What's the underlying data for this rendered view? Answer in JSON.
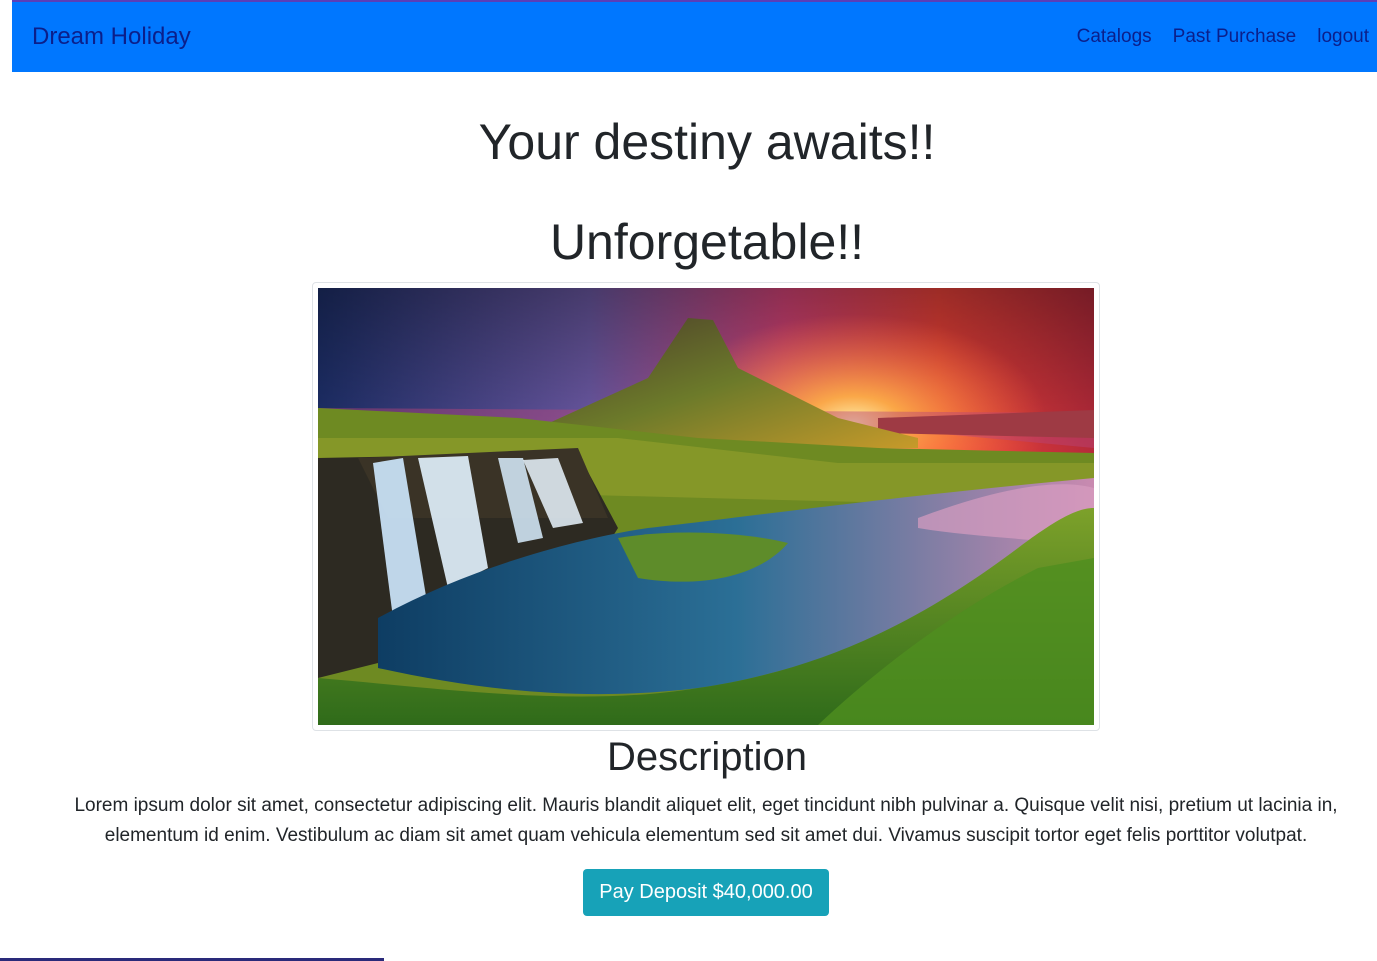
{
  "colors": {
    "navbar_bg": "#0077ff",
    "nav_text": "#0b1f8a",
    "button_bg": "#17a2b8"
  },
  "navbar": {
    "brand": "Dream Holiday",
    "links": [
      {
        "label": "Catalogs"
      },
      {
        "label": "Past Purchase"
      },
      {
        "label": "logout"
      }
    ]
  },
  "main": {
    "heading": "Your destiny awaits!!",
    "subheading": "Unforgetable!!",
    "image": {
      "subject": "waterfall-mountain-sunset-landscape"
    },
    "description_title": "Description",
    "description_text": "Lorem ipsum dolor sit amet, consectetur adipiscing elit. Mauris blandit aliquet elit, eget tincidunt nibh pulvinar a. Quisque velit nisi, pretium ut lacinia in, elementum id enim. Vestibulum ac diam sit amet quam vehicula elementum sed sit amet dui. Vivamus suscipit tortor eget felis porttitor volutpat.",
    "pay_button_label": "Pay Deposit $40,000.00"
  }
}
